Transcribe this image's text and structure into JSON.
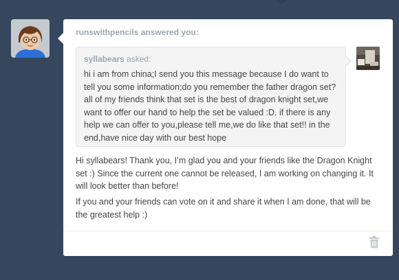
{
  "post": {
    "answerer": "runswithpencils",
    "answered_suffix": " answered you:",
    "asker": "syllabears",
    "asked_suffix": " asked:",
    "question": "hi i am from china;I send you this message because I do want to tell you some information;do you remember the father dragon set? all of my friends think that set is the best of dragon knight set,we want to offer our hand to help the set be valued :D. if there is any help we can offer to you,please tell me,we do like that set!! in the end,have nice day with our best hope",
    "answer_paragraphs": [
      "Hi syllabears!  Thank you, I’m glad you and your friends like the Dragon Knight set :)  Since the current one cannot be released, I am working on changing it. It will look better than before!",
      "If you and your friends can vote on it and share it when I am done, that will be the greatest help :)"
    ]
  },
  "icons": {
    "answerer_avatar": "cartoon-avatar-icon",
    "asker_avatar": "photo-avatar-icon",
    "delete": "trash-icon"
  },
  "colors": {
    "background": "#36465d",
    "card": "#ffffff",
    "ask_box": "#f4f4f4",
    "muted_text": "#9da6af",
    "body_text": "#444444"
  }
}
